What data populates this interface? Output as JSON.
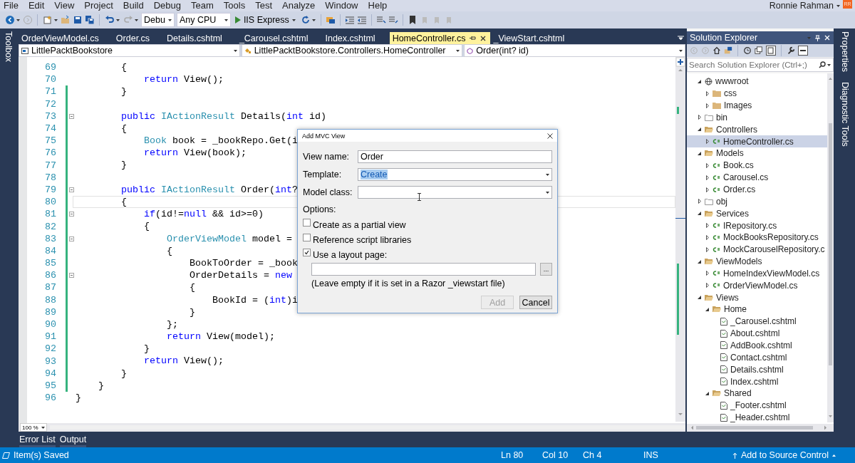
{
  "menu_bar": {
    "items": [
      "File",
      "Edit",
      "View",
      "Project",
      "Build",
      "Debug",
      "Team",
      "Tools",
      "Test",
      "Analyze",
      "Window",
      "Help"
    ],
    "user": {
      "name": "Ronnie Rahman",
      "initials": "RR"
    }
  },
  "toolbar": {
    "configuration": "Debu",
    "platform": "Any CPU",
    "run_target": "IIS Express"
  },
  "left_strip": {
    "tabs": [
      "Toolbox"
    ]
  },
  "editor": {
    "tabs": [
      {
        "label": "OrderViewModel.cs",
        "selected": false
      },
      {
        "label": "Order.cs",
        "selected": false
      },
      {
        "label": "Details.cshtml",
        "selected": false
      },
      {
        "label": "_Carousel.cshtml",
        "selected": false
      },
      {
        "label": "Index.cshtml",
        "selected": false
      },
      {
        "label": "HomeController.cs",
        "selected": true
      },
      {
        "label": "_ViewStart.cshtml",
        "selected": false
      }
    ],
    "navigation": {
      "project": "LittlePacktBookstore",
      "type": "LittlePacktBookstore.Controllers.HomeController",
      "member": "Order(int? id)"
    },
    "lines": [
      {
        "number": "69",
        "changed": false,
        "foldable": false,
        "current": false,
        "tokens": [
          {
            "kind": "plain",
            "text": "        {"
          }
        ]
      },
      {
        "number": "70",
        "changed": false,
        "foldable": false,
        "current": false,
        "tokens": [
          {
            "kind": "kw",
            "text": "            return"
          },
          {
            "kind": "plain",
            "text": " View();"
          }
        ]
      },
      {
        "number": "71",
        "changed": true,
        "foldable": false,
        "current": false,
        "tokens": [
          {
            "kind": "plain",
            "text": "        }"
          }
        ]
      },
      {
        "number": "72",
        "changed": true,
        "foldable": false,
        "current": false
      },
      {
        "number": "73",
        "changed": true,
        "foldable": true,
        "current": false,
        "tokens": [
          {
            "kind": "kw",
            "text": "        public "
          },
          {
            "kind": "type",
            "text": "IActionResult"
          },
          {
            "kind": "plain",
            "text": " Details("
          },
          {
            "kind": "kw",
            "text": "int"
          },
          {
            "kind": "plain",
            "text": " id)"
          }
        ]
      },
      {
        "number": "74",
        "changed": true,
        "foldable": false,
        "current": false,
        "tokens": [
          {
            "kind": "plain",
            "text": "        {"
          }
        ]
      },
      {
        "number": "75",
        "changed": true,
        "foldable": false,
        "current": false,
        "tokens": [
          {
            "kind": "type",
            "text": "            Book"
          },
          {
            "kind": "plain",
            "text": " book = _bookRepo.Get(i"
          }
        ]
      },
      {
        "number": "76",
        "changed": true,
        "foldable": false,
        "current": false,
        "tokens": [
          {
            "kind": "kw",
            "text": "            return"
          },
          {
            "kind": "plain",
            "text": " View(book);"
          }
        ]
      },
      {
        "number": "77",
        "changed": true,
        "foldable": false,
        "current": false,
        "tokens": [
          {
            "kind": "plain",
            "text": "        }"
          }
        ]
      },
      {
        "number": "78",
        "changed": true,
        "foldable": false,
        "current": false
      },
      {
        "number": "79",
        "changed": true,
        "foldable": true,
        "current": false,
        "tokens": [
          {
            "kind": "kw",
            "text": "        public "
          },
          {
            "kind": "type",
            "text": "IActionResult"
          },
          {
            "kind": "plain",
            "text": " Order("
          },
          {
            "kind": "kw",
            "text": "int"
          },
          {
            "kind": "plain",
            "text": "?"
          }
        ]
      },
      {
        "number": "80",
        "changed": true,
        "foldable": false,
        "current": true,
        "tokens": [
          {
            "kind": "plain",
            "text": "        {"
          }
        ]
      },
      {
        "number": "81",
        "changed": true,
        "foldable": true,
        "current": false,
        "tokens": [
          {
            "kind": "kw",
            "text": "            if"
          },
          {
            "kind": "plain",
            "text": "(id!="
          },
          {
            "kind": "kw",
            "text": "null"
          },
          {
            "kind": "plain",
            "text": " && id>=0)"
          }
        ]
      },
      {
        "number": "82",
        "changed": true,
        "foldable": false,
        "current": false,
        "tokens": [
          {
            "kind": "plain",
            "text": "            {"
          }
        ]
      },
      {
        "number": "83",
        "changed": true,
        "foldable": true,
        "current": false,
        "tokens": [
          {
            "kind": "type",
            "text": "                OrderViewModel"
          },
          {
            "kind": "plain",
            "text": " model ="
          }
        ]
      },
      {
        "number": "84",
        "changed": true,
        "foldable": false,
        "current": false,
        "tokens": [
          {
            "kind": "plain",
            "text": "                {"
          }
        ]
      },
      {
        "number": "85",
        "changed": true,
        "foldable": false,
        "current": false,
        "tokens": [
          {
            "kind": "plain",
            "text": "                    BookToOrder = _book"
          }
        ]
      },
      {
        "number": "86",
        "changed": true,
        "foldable": true,
        "current": false,
        "tokens": [
          {
            "kind": "plain",
            "text": "                    OrderDetails = "
          },
          {
            "kind": "kw",
            "text": "new"
          }
        ]
      },
      {
        "number": "87",
        "changed": true,
        "foldable": false,
        "current": false,
        "tokens": [
          {
            "kind": "plain",
            "text": "                    {"
          }
        ]
      },
      {
        "number": "88",
        "changed": true,
        "foldable": false,
        "current": false,
        "tokens": [
          {
            "kind": "plain",
            "text": "                        BookId = ("
          },
          {
            "kind": "kw",
            "text": "int"
          },
          {
            "kind": "plain",
            "text": ")i"
          }
        ]
      },
      {
        "number": "89",
        "changed": true,
        "foldable": false,
        "current": false,
        "tokens": [
          {
            "kind": "plain",
            "text": "                    }"
          }
        ]
      },
      {
        "number": "90",
        "changed": true,
        "foldable": false,
        "current": false,
        "tokens": [
          {
            "kind": "plain",
            "text": "                };"
          }
        ]
      },
      {
        "number": "91",
        "changed": true,
        "foldable": false,
        "current": false,
        "tokens": [
          {
            "kind": "kw",
            "text": "                return"
          },
          {
            "kind": "plain",
            "text": " View(model);"
          }
        ]
      },
      {
        "number": "92",
        "changed": true,
        "foldable": false,
        "current": false,
        "tokens": [
          {
            "kind": "plain",
            "text": "            }"
          }
        ]
      },
      {
        "number": "93",
        "changed": true,
        "foldable": false,
        "current": false,
        "tokens": [
          {
            "kind": "kw",
            "text": "            return"
          },
          {
            "kind": "plain",
            "text": " View();"
          }
        ]
      },
      {
        "number": "94",
        "changed": true,
        "foldable": false,
        "current": false,
        "tokens": [
          {
            "kind": "plain",
            "text": "        }"
          }
        ]
      },
      {
        "number": "95",
        "changed": true,
        "foldable": false,
        "current": false,
        "tokens": [
          {
            "kind": "plain",
            "text": "    }"
          }
        ]
      },
      {
        "number": "96",
        "changed": false,
        "foldable": false,
        "current": false,
        "tokens": [
          {
            "kind": "plain",
            "text": "}"
          }
        ]
      }
    ],
    "zoom": "100 %"
  },
  "dialog": {
    "title": "Add MVC View",
    "fields": [
      {
        "label": "View name:",
        "kind": "text",
        "value": "Order"
      },
      {
        "label": "Template:",
        "kind": "select",
        "value": "Create",
        "text_selected": true
      },
      {
        "label": "Model class:",
        "kind": "select"
      }
    ],
    "options_label": "Options:",
    "options": [
      {
        "label": "Create as a partial view",
        "checked": false
      },
      {
        "label": "Reference script libraries",
        "checked": false
      },
      {
        "label": "Use a layout page:",
        "checked": true
      }
    ],
    "browse_button": "...",
    "note": "(Leave empty if it is set in a Razor _viewstart file)",
    "buttons": [
      {
        "label": "Add",
        "disabled": true
      },
      {
        "label": "Cancel",
        "disabled": false
      }
    ]
  },
  "solution_explorer": {
    "title": "Solution Explorer",
    "search": {
      "placeholder": "Search Solution Explorer (Ctrl+;)"
    },
    "tree": [
      {
        "label": "wwwroot",
        "kind": "globe",
        "expanded": true,
        "selected": false,
        "children": [
          {
            "label": "css",
            "kind": "folder",
            "expanded": false,
            "selected": false
          },
          {
            "label": "Images",
            "kind": "folder",
            "expanded": false,
            "selected": false
          }
        ]
      },
      {
        "label": "bin",
        "kind": "hidden-folder",
        "expanded": false,
        "selected": false
      },
      {
        "label": "Controllers",
        "kind": "open-folder",
        "expanded": true,
        "selected": false,
        "children": [
          {
            "label": "HomeController.cs",
            "kind": "csharp",
            "expanded": false,
            "selected": true
          }
        ]
      },
      {
        "label": "Models",
        "kind": "open-folder",
        "expanded": true,
        "selected": false,
        "children": [
          {
            "label": "Book.cs",
            "kind": "csharp",
            "expanded": false,
            "selected": false
          },
          {
            "label": "Carousel.cs",
            "kind": "csharp",
            "expanded": false,
            "selected": false
          },
          {
            "label": "Order.cs",
            "kind": "csharp",
            "expanded": false,
            "selected": false
          }
        ]
      },
      {
        "label": "obj",
        "kind": "hidden-folder",
        "expanded": false,
        "selected": false
      },
      {
        "label": "Services",
        "kind": "open-folder",
        "expanded": true,
        "selected": false,
        "children": [
          {
            "label": "IRepository.cs",
            "kind": "csharp",
            "expanded": false,
            "selected": false
          },
          {
            "label": "MockBooksRepository.cs",
            "kind": "csharp",
            "expanded": false,
            "selected": false
          },
          {
            "label": "MockCarouselRepository.c",
            "kind": "csharp",
            "expanded": false,
            "selected": false
          }
        ]
      },
      {
        "label": "ViewModels",
        "kind": "open-folder",
        "expanded": true,
        "selected": false,
        "children": [
          {
            "label": "HomeIndexViewModel.cs",
            "kind": "csharp",
            "expanded": false,
            "selected": false
          },
          {
            "label": "OrderViewModel.cs",
            "kind": "csharp",
            "expanded": false,
            "selected": false
          }
        ]
      },
      {
        "label": "Views",
        "kind": "open-folder",
        "expanded": true,
        "selected": false,
        "children": [
          {
            "label": "Home",
            "kind": "open-folder",
            "expanded": true,
            "selected": false,
            "children": [
              {
                "label": "_Carousel.cshtml",
                "kind": "razor",
                "selected": false
              },
              {
                "label": "About.cshtml",
                "kind": "razor",
                "selected": false
              },
              {
                "label": "AddBook.cshtml",
                "kind": "razor",
                "selected": false
              },
              {
                "label": "Contact.cshtml",
                "kind": "razor",
                "selected": false
              },
              {
                "label": "Details.cshtml",
                "kind": "razor",
                "selected": false
              },
              {
                "label": "Index.cshtml",
                "kind": "razor",
                "selected": false
              }
            ]
          },
          {
            "label": "Shared",
            "kind": "open-folder",
            "expanded": true,
            "selected": false,
            "children": [
              {
                "label": "_Footer.cshtml",
                "kind": "razor",
                "selected": false
              },
              {
                "label": "_Header.cshtml",
                "kind": "razor",
                "selected": false
              }
            ]
          }
        ]
      }
    ]
  },
  "right_strip": {
    "tabs": [
      "Properties",
      "Diagnostic Tools"
    ]
  },
  "bottom_tabs": [
    "Error List",
    "Output"
  ],
  "status_bar": {
    "message": "Item(s) Saved",
    "line": "Ln 80",
    "column": "Col 10",
    "char": "Ch 4",
    "mode": "INS",
    "source_control": "Add to Source Control"
  }
}
